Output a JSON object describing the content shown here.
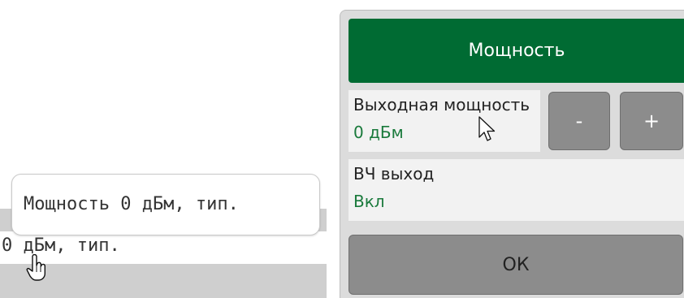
{
  "colors": {
    "title_bar": "#006b33",
    "value_text": "#1a7a3c",
    "button": "#8c8c8c"
  },
  "tooltip": {
    "text": "Мощность 0 дБм, тип."
  },
  "table_cell": {
    "text": "0 дБм, тип."
  },
  "dialog": {
    "title": "Мощность",
    "output_power": {
      "label": "Выходная мощность",
      "value": "0 дБм"
    },
    "decrement_label": "-",
    "increment_label": "+",
    "rf_output": {
      "label": "ВЧ выход",
      "value": "Вкл"
    },
    "ok_label": "ОК"
  },
  "icons": {
    "pointer": "hand-pointer-icon",
    "arrow": "mouse-arrow-icon"
  }
}
